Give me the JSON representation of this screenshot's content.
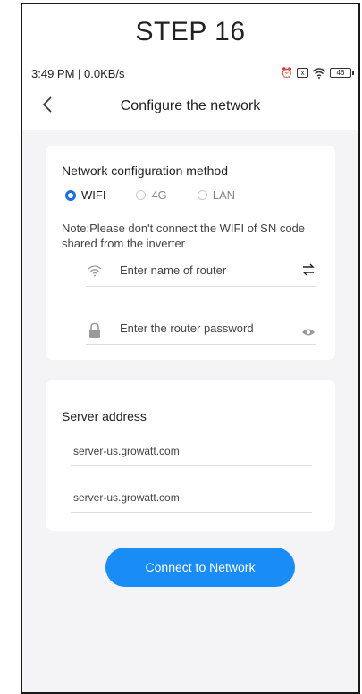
{
  "step_title": "STEP 16",
  "status_bar": {
    "time": "3:49 PM | 0.0KB/s",
    "battery": "46"
  },
  "nav": {
    "back_icon": "chevron-left",
    "title": "Configure the network"
  },
  "network_config": {
    "label": "Network configuration method",
    "options": [
      {
        "label": "WIFI",
        "selected": true
      },
      {
        "label": "4G",
        "selected": false
      },
      {
        "label": "LAN",
        "selected": false
      }
    ],
    "note": "Note:Please don't connect the WIFI of SN code shared from the inverter",
    "router_name_placeholder": "Enter name of router",
    "router_password_placeholder": "Enter the router password"
  },
  "server": {
    "label": "Server address",
    "address_1": "server-us.growatt.com",
    "address_2": "server-us.growatt.com"
  },
  "connect_button": "Connect to Network",
  "colors": {
    "accent": "#1a8cf5",
    "radio_selected": "#1a6fe0",
    "content_background": "#f4f4f6"
  }
}
